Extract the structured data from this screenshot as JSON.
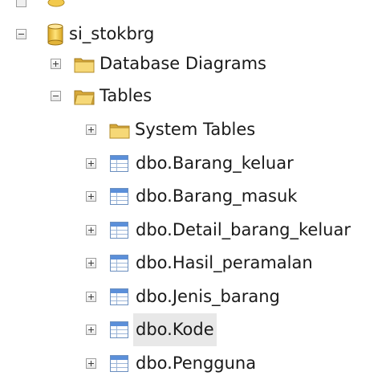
{
  "tree": {
    "database": {
      "label": "si_stokbrg",
      "expander": "minus"
    },
    "children": [
      {
        "label": "Database Diagrams",
        "icon": "folder-icon",
        "expander": "plus"
      },
      {
        "label": "Tables",
        "icon": "folder-icon",
        "expander": "minus"
      }
    ],
    "tables": [
      {
        "label": "System Tables",
        "icon": "folder-icon",
        "expander": "plus"
      },
      {
        "label": "dbo.Barang_keluar",
        "icon": "table-icon",
        "expander": "plus"
      },
      {
        "label": "dbo.Barang_masuk",
        "icon": "table-icon",
        "expander": "plus"
      },
      {
        "label": "dbo.Detail_barang_keluar",
        "icon": "table-icon",
        "expander": "plus"
      },
      {
        "label": "dbo.Hasil_peramalan",
        "icon": "table-icon",
        "expander": "plus"
      },
      {
        "label": "dbo.Jenis_barang",
        "icon": "table-icon",
        "expander": "plus"
      },
      {
        "label": "dbo.Kode",
        "icon": "table-icon",
        "expander": "plus",
        "selected": true
      },
      {
        "label": "dbo.Pengguna",
        "icon": "table-icon",
        "expander": "plus"
      }
    ]
  },
  "colors": {
    "folder": "#f3cf63",
    "folder_dark": "#d7a93a",
    "database": "#f2c94c",
    "table_header": "#5b8fd9",
    "selection": "#e8e8e8"
  }
}
